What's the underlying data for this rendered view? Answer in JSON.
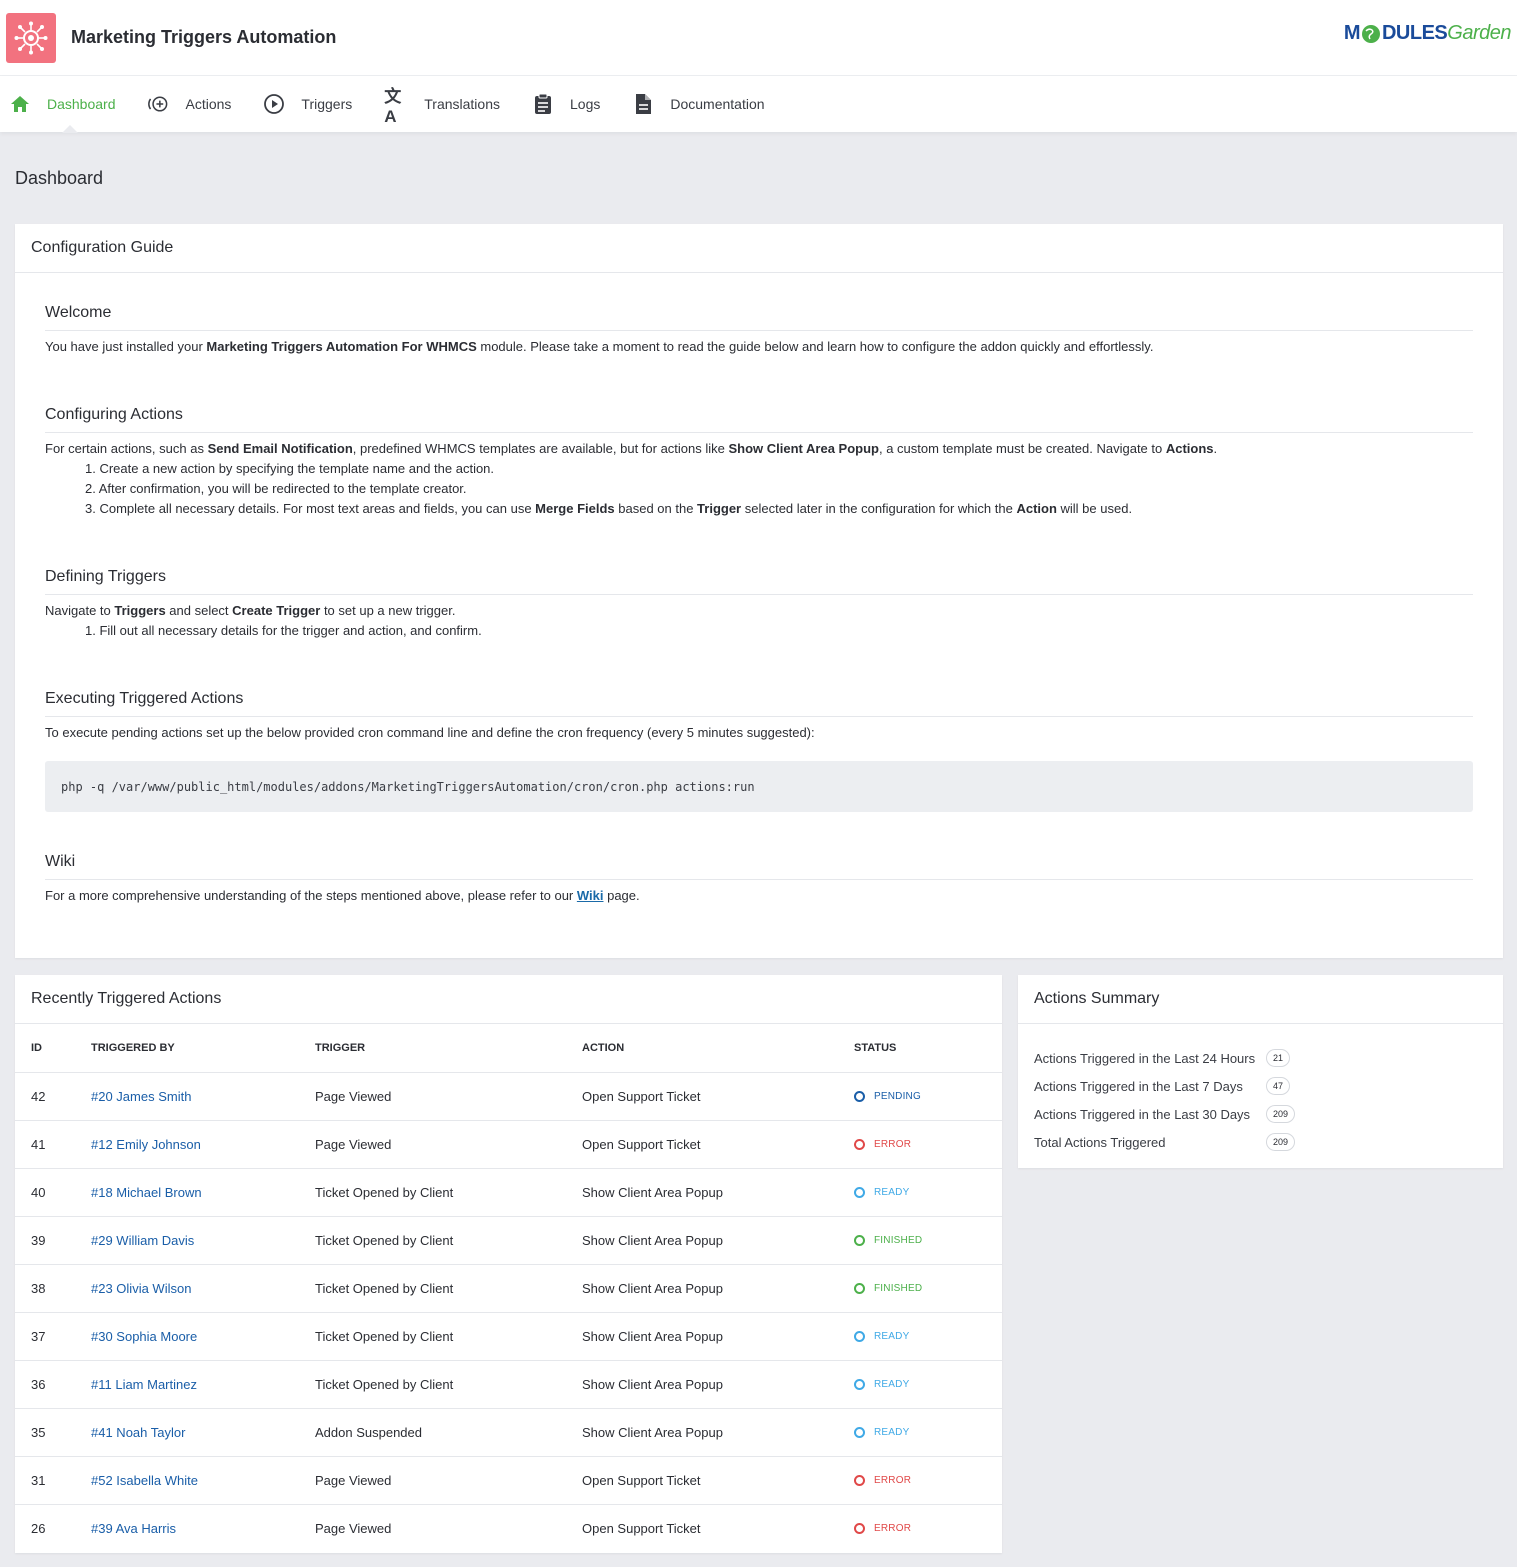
{
  "app": {
    "title": "Marketing Triggers Automation",
    "brand_a": "M",
    "brand_b": "DULES",
    "brand_c": "Garden"
  },
  "nav": [
    {
      "label": "Dashboard",
      "icon": "home-icon",
      "active": true
    },
    {
      "label": "Actions",
      "icon": "add-circle-icon"
    },
    {
      "label": "Triggers",
      "icon": "play-circle-icon"
    },
    {
      "label": "Translations",
      "icon": "translate-icon"
    },
    {
      "label": "Logs",
      "icon": "clipboard-icon"
    },
    {
      "label": "Documentation",
      "icon": "document-icon"
    }
  ],
  "page_title": "Dashboard",
  "guide": {
    "title": "Configuration Guide",
    "welcome": {
      "title": "Welcome",
      "p1": "You have just installed your ",
      "b1": "Marketing Triggers Automation For WHMCS",
      "p2": " module. Please take a moment to read the guide below and learn how to configure the addon quickly and effortlessly."
    },
    "actions": {
      "title": "Configuring Actions",
      "p1": "For certain actions, such as ",
      "b1": "Send Email Notification",
      "p2": ", predefined WHMCS templates are available, but for actions like ",
      "b2": "Show Client Area Popup",
      "p3": ", a custom template must be created. Navigate to ",
      "b3": "Actions",
      "p4": ".",
      "li1": "1. Create a new action by specifying the template name and the action.",
      "li2": "2. After confirmation, you will be redirected to the template creator.",
      "li3a": "3. Complete all necessary details. For most text areas and fields, you can use ",
      "li3b": "Merge Fields",
      "li3c": " based on the ",
      "li3d": "Trigger",
      "li3e": " selected later in the configuration for which the ",
      "li3f": "Action",
      "li3g": " will be used."
    },
    "triggers": {
      "title": "Defining Triggers",
      "p1": "Navigate to ",
      "b1": "Triggers",
      "p2": " and select ",
      "b2": "Create Trigger",
      "p3": " to set up a new trigger.",
      "li1": "1. Fill out all necessary details for the trigger and action, and confirm."
    },
    "executing": {
      "title": "Executing Triggered Actions",
      "p1": "To execute pending actions set up the below provided cron command line and define the cron frequency (every 5 minutes suggested):",
      "code": "php -q /var/www/public_html/modules/addons/MarketingTriggersAutomation/cron/cron.php actions:run"
    },
    "wiki": {
      "title": "Wiki",
      "p1": "For a more comprehensive understanding of the steps mentioned above, please refer to our ",
      "link": "Wiki",
      "p2": " page."
    }
  },
  "recent": {
    "title": "Recently Triggered Actions",
    "columns": [
      "ID",
      "TRIGGERED BY",
      "TRIGGER",
      "ACTION",
      "STATUS"
    ],
    "rows": [
      {
        "id": "42",
        "by": "#20 James Smith",
        "trigger": "Page Viewed",
        "action": "Open Support Ticket",
        "status": "PENDING",
        "color": "#1a5ea8"
      },
      {
        "id": "41",
        "by": "#12 Emily Johnson",
        "trigger": "Page Viewed",
        "action": "Open Support Ticket",
        "status": "ERROR",
        "color": "#e04848"
      },
      {
        "id": "40",
        "by": "#18 Michael Brown",
        "trigger": "Ticket Opened by Client",
        "action": "Show Client Area Popup",
        "status": "READY",
        "color": "#3fa9e6"
      },
      {
        "id": "39",
        "by": "#29 William Davis",
        "trigger": "Ticket Opened by Client",
        "action": "Show Client Area Popup",
        "status": "FINISHED",
        "color": "#4cb04a"
      },
      {
        "id": "38",
        "by": "#23 Olivia Wilson",
        "trigger": "Ticket Opened by Client",
        "action": "Show Client Area Popup",
        "status": "FINISHED",
        "color": "#4cb04a"
      },
      {
        "id": "37",
        "by": "#30 Sophia Moore",
        "trigger": "Ticket Opened by Client",
        "action": "Show Client Area Popup",
        "status": "READY",
        "color": "#3fa9e6"
      },
      {
        "id": "36",
        "by": "#11 Liam Martinez",
        "trigger": "Ticket Opened by Client",
        "action": "Show Client Area Popup",
        "status": "READY",
        "color": "#3fa9e6"
      },
      {
        "id": "35",
        "by": "#41 Noah Taylor",
        "trigger": "Addon Suspended",
        "action": "Show Client Area Popup",
        "status": "READY",
        "color": "#3fa9e6"
      },
      {
        "id": "31",
        "by": "#52 Isabella White",
        "trigger": "Page Viewed",
        "action": "Open Support Ticket",
        "status": "ERROR",
        "color": "#e04848"
      },
      {
        "id": "26",
        "by": "#39 Ava Harris",
        "trigger": "Page Viewed",
        "action": "Open Support Ticket",
        "status": "ERROR",
        "color": "#e04848"
      }
    ]
  },
  "summary": {
    "title": "Actions Summary",
    "items": [
      {
        "label": "Actions Triggered in the Last 24 Hours",
        "value": "21"
      },
      {
        "label": "Actions Triggered in the Last 7 Days",
        "value": "47"
      },
      {
        "label": "Actions Triggered in the Last 30 Days",
        "value": "209"
      },
      {
        "label": "Total Actions Triggered",
        "value": "209"
      }
    ]
  },
  "colors": {
    "accent": "#4cb04a",
    "logo_bg": "#f2727f",
    "link": "#1a5ea8"
  }
}
